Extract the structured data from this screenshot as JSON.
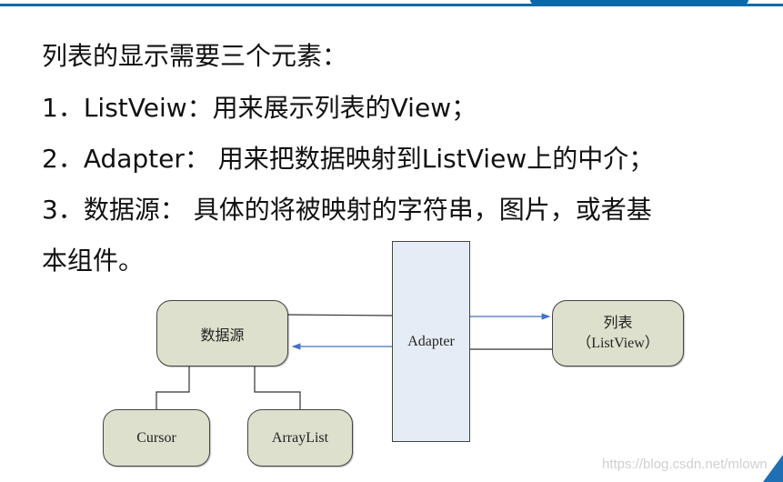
{
  "text": {
    "heading": "列表的显示需要三个元素：",
    "item1": "1．ListVeiw：用来展示列表的View；",
    "item2": "2．Adapter： 用来把数据映射到ListView上的中介；",
    "item3a": "3．数据源： 具体的将被映射的字符串，图片，或者基",
    "item3b": "本组件。"
  },
  "diagram": {
    "datasource": "数据源",
    "adapter": "Adapter",
    "listview_line1": "列表",
    "listview_line2": "（ListView）",
    "cursor": "Cursor",
    "arraylist": "ArrayList",
    "arrow_color": "#4472c4",
    "box_fill": "#dde0cc",
    "adapter_fill": "#e6ecf5"
  },
  "watermark": "https://blog.csdn.net/mlown",
  "accent_color": "#0a6aa8"
}
